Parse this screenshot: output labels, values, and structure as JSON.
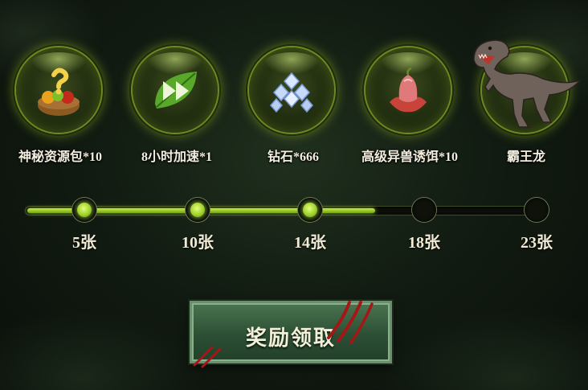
{
  "rewards": [
    {
      "icon": "mystery-resource-basket-icon",
      "label": "神秘资源包*10"
    },
    {
      "icon": "speedup-leaf-arrows-icon",
      "label": "8小时加速*1"
    },
    {
      "icon": "diamond-pile-icon",
      "label": "钻石*666"
    },
    {
      "icon": "lure-flower-icon",
      "label": "高级异兽诱饵*10"
    },
    {
      "icon": "tyrannosaurus-icon",
      "label": "霸王龙"
    }
  ],
  "progress": {
    "milestones": [
      "5张",
      "10张",
      "14张",
      "18张",
      "23张"
    ],
    "reached_count": 3,
    "fill_fraction": 0.67
  },
  "claim_button": {
    "label": "奖励领取"
  },
  "colors": {
    "accent": "#b8e23a",
    "button": "#3a6442",
    "claw": "#b01818"
  }
}
